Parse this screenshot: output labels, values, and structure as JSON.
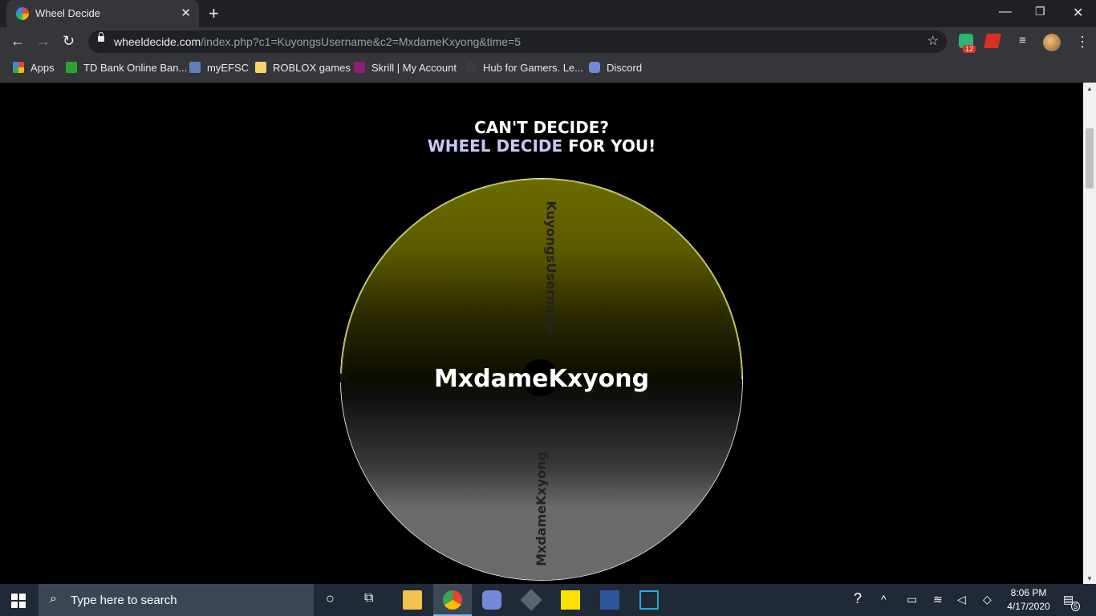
{
  "browser": {
    "tab_title": "Wheel Decide",
    "url_host": "wheeldecide.com",
    "url_path": "/index.php?c1=KuyongsUsername&c2=MxdameKxyong&time=5",
    "extension_badge": "12"
  },
  "bookmarks": [
    {
      "label": "Apps",
      "icon": "apps-grid-icon"
    },
    {
      "label": "TD Bank Online Ban...",
      "icon": "td-bank-icon"
    },
    {
      "label": "myEFSC",
      "icon": "efsc-icon"
    },
    {
      "label": "ROBLOX games",
      "icon": "folder-icon"
    },
    {
      "label": "Skrill | My Account",
      "icon": "skrill-icon"
    },
    {
      "label": "Hub for Gamers. Le...",
      "icon": "hub-icon"
    },
    {
      "label": "Discord",
      "icon": "discord-icon"
    }
  ],
  "page": {
    "heading_line1": "CAN'T DECIDE?",
    "heading_accent": "WHEEL DECIDE",
    "heading_rest": " FOR YOU!",
    "result": "MxdameKxyong",
    "segments": [
      "KuyongsUsername",
      "MxdameKxyong"
    ],
    "colors": {
      "segment1": "#6b6b00",
      "segment2": "#6a6a6a",
      "accent": "#c6c7f3"
    }
  },
  "taskbar": {
    "search_placeholder": "Type here to search",
    "time": "8:06 PM",
    "date": "4/17/2020",
    "notification_count": "5"
  }
}
